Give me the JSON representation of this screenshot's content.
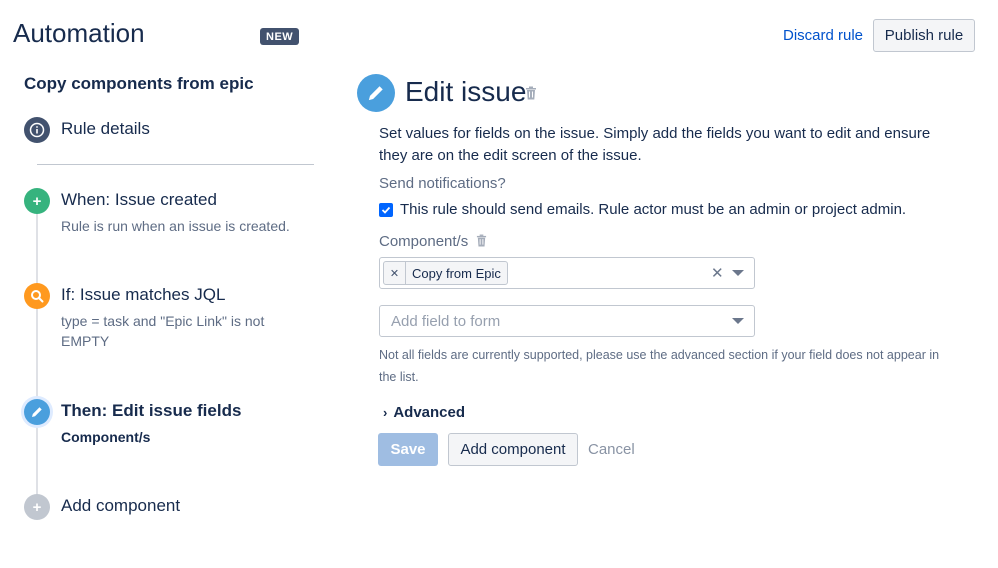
{
  "header": {
    "title": "Automation",
    "badge": "NEW",
    "discard_label": "Discard rule",
    "publish_label": "Publish rule"
  },
  "sidebar": {
    "rule_name": "Copy components from epic",
    "rule_details": "Rule details",
    "steps": [
      {
        "title": "When: Issue created",
        "desc": "Rule is run when an issue is created.",
        "color": "#36b37e",
        "icon": "plus-icon"
      },
      {
        "title": "If: Issue matches JQL",
        "desc": "type = task and \"Epic Link\" is not EMPTY",
        "color": "#ff991f",
        "icon": "magnifier-icon"
      },
      {
        "title": "Then: Edit issue fields",
        "desc": "Component/s",
        "color": "#4a9fdd",
        "icon": "pencil-icon"
      },
      {
        "title": "Add component",
        "desc": "",
        "color": "#c1c7d0",
        "icon": "plus-icon"
      }
    ]
  },
  "editor": {
    "title": "Edit issue",
    "description": "Set values for fields on the issue. Simply add the fields you want to edit and ensure they are on the edit screen of the issue.",
    "notifications_label": "Send notifications?",
    "checkbox_label": "This rule should send emails. Rule actor must be an admin or project admin.",
    "checkbox_checked": true,
    "component_label": "Component/s",
    "component_tag": "Copy from Epic",
    "add_field_placeholder": "Add field to form",
    "help_text": "Not all fields are currently supported, please use the advanced section if your field does not appear in the list.",
    "advanced_label": "Advanced",
    "save_label": "Save",
    "add_component_label": "Add component",
    "cancel_label": "Cancel"
  }
}
